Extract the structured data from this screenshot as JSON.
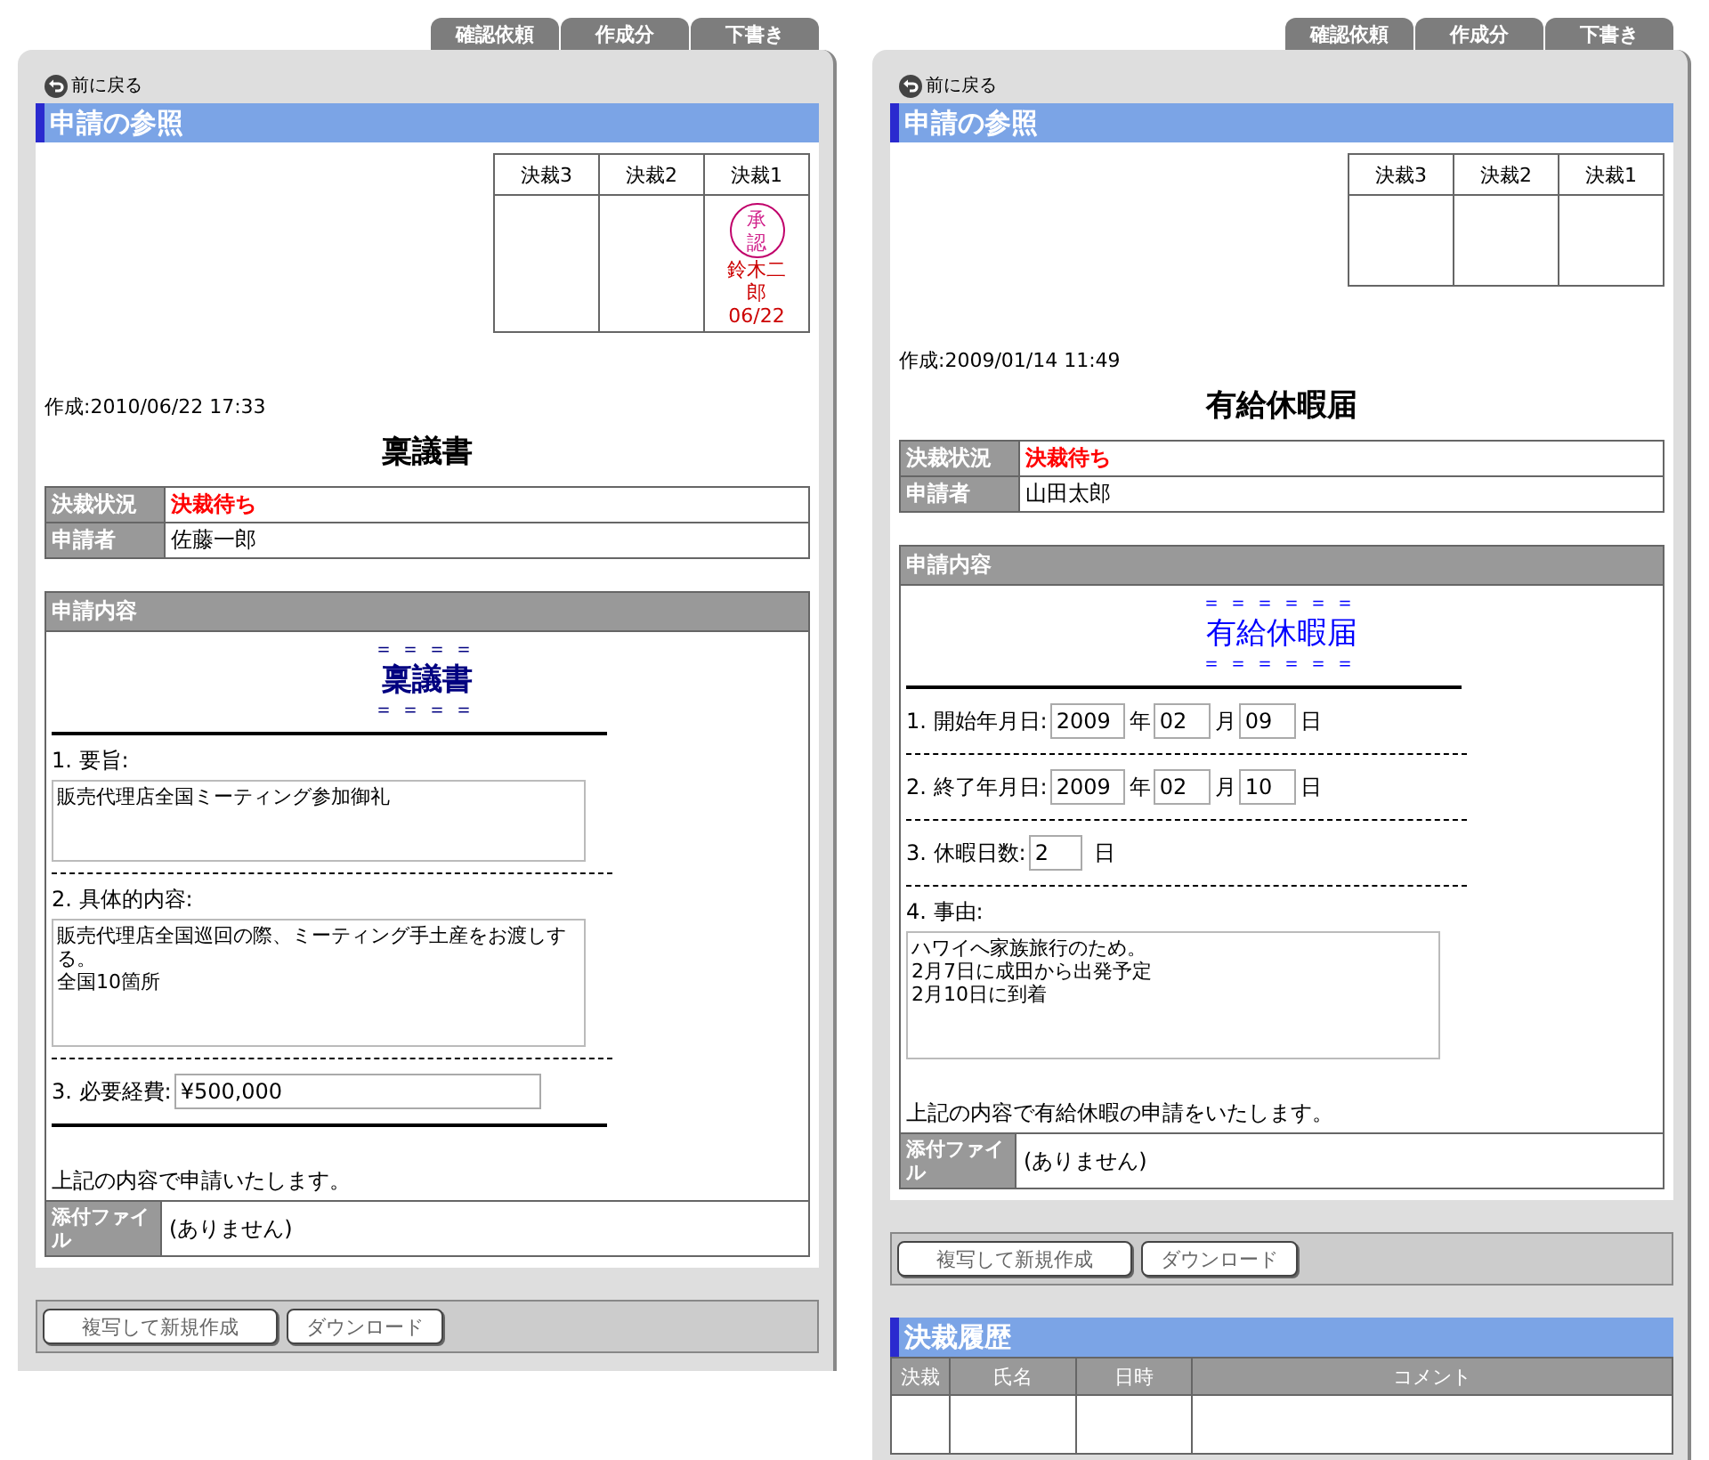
{
  "panels": [
    {
      "tabs": [
        {
          "label": "確認依頼",
          "selected": false
        },
        {
          "label": "作成分",
          "selected": false
        },
        {
          "label": "下書き",
          "selected": false
        }
      ],
      "back_link": "前に戻る",
      "heading": "申請の参照",
      "approvals": [
        {
          "label": "決裁3"
        },
        {
          "label": "決裁2"
        },
        {
          "label": "決裁1",
          "stamp": "承認",
          "approver": "鈴木二郎",
          "date": "06/22"
        }
      ],
      "created": "作成:2010/06/22 17:33",
      "doc_title": "稟議書",
      "info": [
        {
          "label": "決裁状況",
          "value": "決裁待ち",
          "kind": "status"
        },
        {
          "label": "申請者",
          "value": "佐藤一郎",
          "kind": "plain"
        }
      ],
      "content": {
        "heading": "申請内容",
        "rule_text": "＝＝＝＝",
        "form_title": "稟議書",
        "color": "#000080",
        "bold_title": true,
        "fields": [
          {
            "kind": "solid_rule"
          },
          {
            "kind": "short_textarea",
            "label": "1. 要旨:",
            "lines": [
              "販売代理店全国ミーティング参加御礼"
            ]
          },
          {
            "kind": "dashed_rule"
          },
          {
            "kind": "tall_textarea",
            "label": "2. 具体的内容:",
            "lines": [
              "販売代理店全国巡回の際、ミーティング手土産をお渡しする。",
              "全国10箇所"
            ]
          },
          {
            "kind": "dashed_rule"
          },
          {
            "kind": "text",
            "label": "3. 必要経費:",
            "value": "¥500,000"
          },
          {
            "kind": "solid_rule"
          },
          {
            "kind": "note",
            "value": "上記の内容で申請いたします。"
          }
        ],
        "attachment_label": "添付ファイル",
        "attachment": "(ありません)"
      },
      "buttons": [
        "複写して新規作成",
        "ダウンロード"
      ]
    },
    {
      "tabs": [
        {
          "label": "確認依頼",
          "selected": false
        },
        {
          "label": "作成分",
          "selected": false
        },
        {
          "label": "下書き",
          "selected": false
        }
      ],
      "back_link": "前に戻る",
      "heading": "申請の参照",
      "approvals": [
        {
          "label": "決裁3"
        },
        {
          "label": "決裁2"
        },
        {
          "label": "決裁1"
        }
      ],
      "created": "作成:2009/01/14 11:49",
      "doc_title": "有給休暇届",
      "info": [
        {
          "label": "決裁状況",
          "value": "決裁待ち",
          "kind": "status"
        },
        {
          "label": "申請者",
          "value": "山田太郎",
          "kind": "plain"
        }
      ],
      "content": {
        "heading": "申請内容",
        "rule_text": "＝＝＝＝＝＝",
        "form_title": "有給休暇届",
        "color": "#0000ff",
        "bold_title": false,
        "fields": [
          {
            "kind": "solid_rule"
          },
          {
            "kind": "date",
            "label": "1. 開始年月日:",
            "parts": [
              {
                "value": "2009",
                "unit": "年"
              },
              {
                "value": "02",
                "unit": "月"
              },
              {
                "value": "09",
                "unit": "日"
              }
            ]
          },
          {
            "kind": "dashed_rule"
          },
          {
            "kind": "date",
            "label": "2. 終了年月日:",
            "parts": [
              {
                "value": "2009",
                "unit": "年"
              },
              {
                "value": "02",
                "unit": "月"
              },
              {
                "value": "10",
                "unit": "日"
              }
            ]
          },
          {
            "kind": "dashed_rule"
          },
          {
            "kind": "date",
            "label": "3. 休暇日数:",
            "parts": [
              {
                "value": "2",
                "unit": "日"
              }
            ]
          },
          {
            "kind": "dashed_rule"
          },
          {
            "kind": "tall_textarea",
            "label": "4. 事由:",
            "lines": [
              "ハワイへ家族旅行のため。",
              "2月7日に成田から出発予定",
              "2月10日に到着"
            ]
          },
          {
            "kind": "note",
            "value": "上記の内容で有給休暇の申請をいたします。"
          }
        ],
        "attachment_label": "添付ファイル",
        "attachment": "(ありません)"
      },
      "buttons": [
        "複写して新規作成",
        "ダウンロード"
      ],
      "history": {
        "heading": "決裁履歴",
        "columns": [
          "決裁",
          "氏名",
          "日時",
          "コメント"
        ]
      }
    }
  ]
}
